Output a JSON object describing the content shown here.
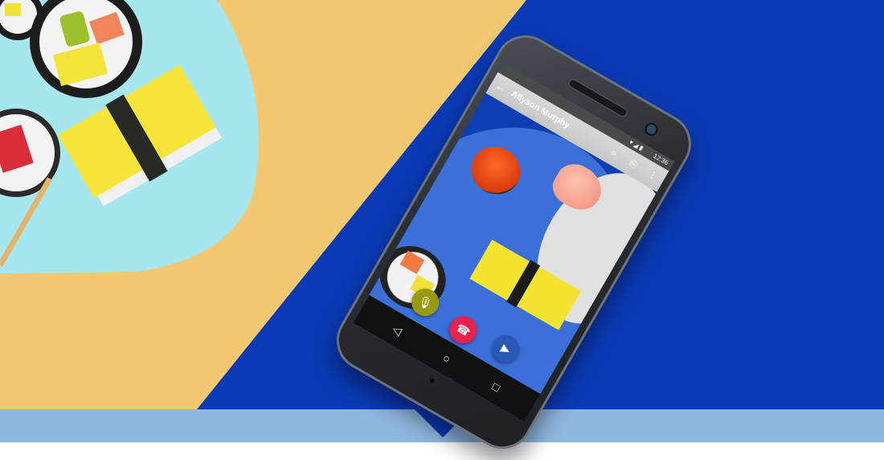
{
  "scene": {
    "colors": {
      "left_background": "#f3c873",
      "right_background": "#0a3ab5",
      "plate": "#a6e6ef",
      "bottom_bar": "#8fb8dd"
    }
  },
  "phone": {
    "status_bar": {
      "time": "12:36",
      "icons": [
        "wifi-icon",
        "signal-icon",
        "battery-icon"
      ]
    },
    "app_bar": {
      "back_icon": "arrow-left-icon",
      "contact_name": "Allyson Murphy",
      "actions": [
        "filter-icon",
        "switch-camera-icon",
        "more-vert-icon"
      ]
    },
    "call_controls": {
      "mute_icon": "mic-icon",
      "end_call_icon": "phone-hangup-icon",
      "video_icon": "videocam-icon",
      "colors": {
        "mute": "#9a9a12",
        "end_call": "#e8214f",
        "video": "#2a58b6"
      }
    },
    "nav_bar": [
      "back-triangle-icon",
      "home-circle-icon",
      "recents-square-icon"
    ]
  }
}
